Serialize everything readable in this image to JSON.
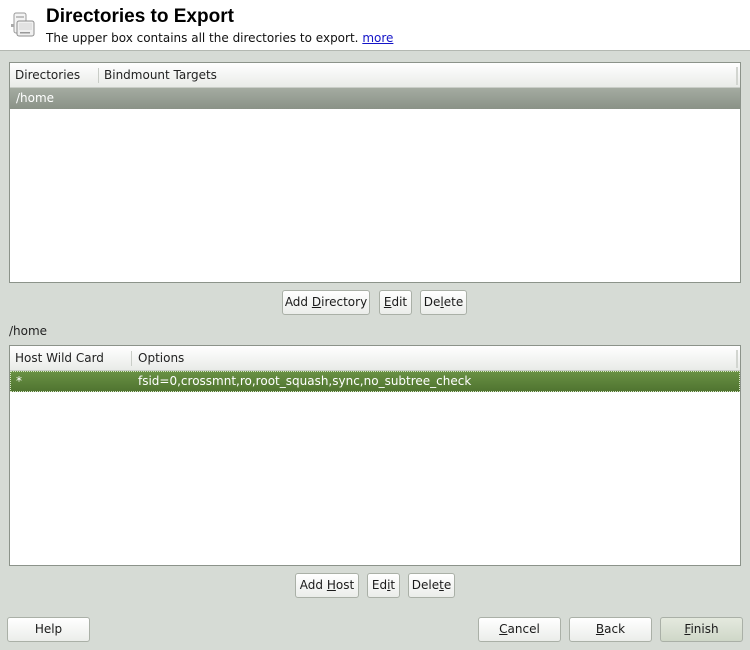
{
  "header": {
    "title": "Directories to Export",
    "subtitle": "The upper box contains all the directories to export.",
    "more_link": "more",
    "icon": "nfs-server-icon"
  },
  "directories_table": {
    "columns": [
      "Directories",
      "Bindmount Targets"
    ],
    "rows": [
      {
        "directory": "/home",
        "bindmount": "",
        "selected": true
      }
    ]
  },
  "directory_buttons": {
    "add": {
      "pre": "Add ",
      "mnemonic": "D",
      "post": "irectory"
    },
    "edit": {
      "pre": "",
      "mnemonic": "E",
      "post": "dit"
    },
    "delete": {
      "pre": "De",
      "mnemonic": "l",
      "post": "ete"
    }
  },
  "selected_directory_label": "/home",
  "hosts_table": {
    "columns": [
      "Host Wild Card",
      "Options"
    ],
    "rows": [
      {
        "host": "*",
        "options": "fsid=0,crossmnt,ro,root_squash,sync,no_subtree_check",
        "selected": true
      }
    ]
  },
  "host_buttons": {
    "add": {
      "pre": "Add ",
      "mnemonic": "H",
      "post": "ost"
    },
    "edit": {
      "pre": "Ed",
      "mnemonic": "i",
      "post": "t"
    },
    "delete": {
      "pre": "Dele",
      "mnemonic": "t",
      "post": "e"
    }
  },
  "footer": {
    "help": "Help",
    "cancel": {
      "pre": "",
      "mnemonic": "C",
      "post": "ancel"
    },
    "back": {
      "pre": "",
      "mnemonic": "B",
      "post": "ack"
    },
    "finish": {
      "pre": "",
      "mnemonic": "F",
      "post": "inish"
    }
  },
  "colors": {
    "background": "#d6dbd5",
    "selection_grey": "#959c92",
    "selection_green": "#5d8339",
    "link": "#1414c8"
  }
}
